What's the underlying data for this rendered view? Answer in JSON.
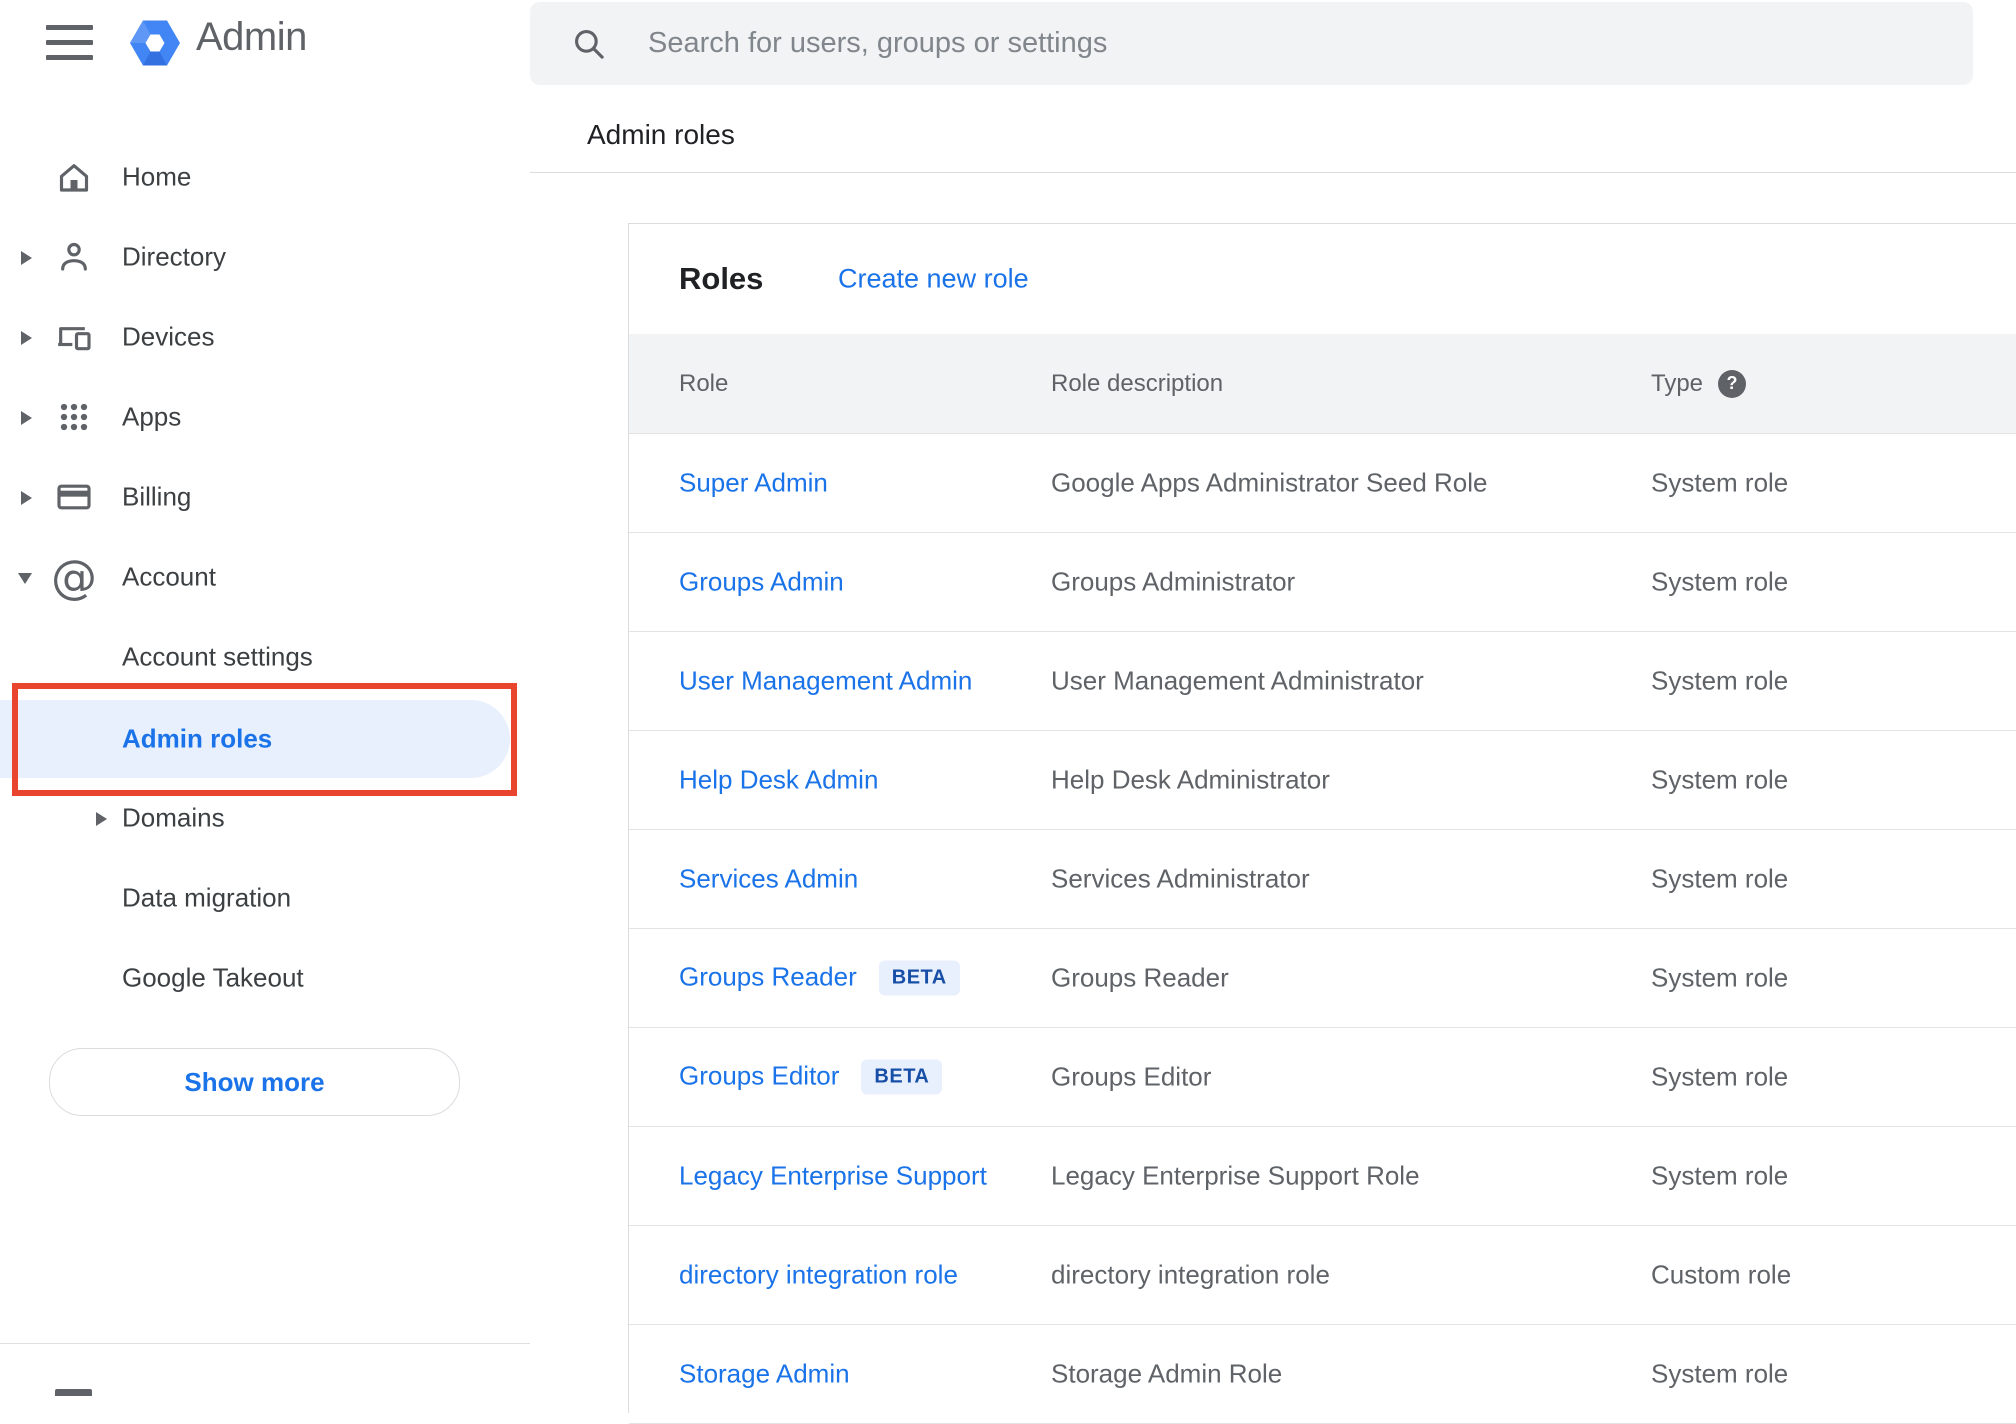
{
  "app": {
    "title": "Admin"
  },
  "colors": {
    "accent_blue": "#1a73e8",
    "annotation_red": "#e8442e",
    "active_item_bg": "#e8f0fe",
    "beta_badge_bg": "#e8f0fe",
    "beta_badge_text": "#174ea6",
    "header_row_bg": "#f1f3f4",
    "icon_gray": "#5f6368"
  },
  "search": {
    "placeholder": "Search for users, groups or settings"
  },
  "breadcrumb": "Admin roles",
  "sidebar": {
    "items": [
      {
        "label": "Home",
        "icon": "home-icon"
      },
      {
        "label": "Directory",
        "icon": "person-icon",
        "arrow": "right"
      },
      {
        "label": "Devices",
        "icon": "devices-icon",
        "arrow": "right"
      },
      {
        "label": "Apps",
        "icon": "apps-grid-icon",
        "arrow": "right"
      },
      {
        "label": "Billing",
        "icon": "credit-card-icon",
        "arrow": "right"
      },
      {
        "label": "Account",
        "icon": "at-sign-icon",
        "icon_glyph": "@",
        "arrow": "down"
      },
      {
        "label": "Account settings"
      },
      {
        "label": "Admin roles",
        "active": true
      },
      {
        "label": "Domains",
        "arrow": "right"
      },
      {
        "label": "Data migration"
      },
      {
        "label": "Google Takeout"
      }
    ],
    "show_more_label": "Show more"
  },
  "roles_card": {
    "title": "Roles",
    "create_link": "Create new role",
    "table": {
      "help_glyph": "?",
      "headers": {
        "role": "Role",
        "description": "Role description",
        "type": "Type"
      },
      "rows": [
        {
          "role": "Super Admin",
          "description": "Google Apps Administrator Seed Role",
          "type": "System role"
        },
        {
          "role": "Groups Admin",
          "description": "Groups Administrator",
          "type": "System role"
        },
        {
          "role": "User Management Admin",
          "description": "User Management Administrator",
          "type": "System role"
        },
        {
          "role": "Help Desk Admin",
          "description": "Help Desk Administrator",
          "type": "System role"
        },
        {
          "role": "Services Admin",
          "description": "Services Administrator",
          "type": "System role"
        },
        {
          "role": "Groups Reader",
          "badge": "BETA",
          "description": "Groups Reader",
          "type": "System role"
        },
        {
          "role": "Groups Editor",
          "badge": "BETA",
          "description": "Groups Editor",
          "type": "System role"
        },
        {
          "role": "Legacy Enterprise Support",
          "description": "Legacy Enterprise Support Role",
          "type": "System role"
        },
        {
          "role": "directory integration role",
          "description": "directory integration role",
          "type": "Custom role"
        },
        {
          "role": "Storage Admin",
          "description": "Storage Admin Role",
          "type": "System role"
        }
      ]
    }
  }
}
